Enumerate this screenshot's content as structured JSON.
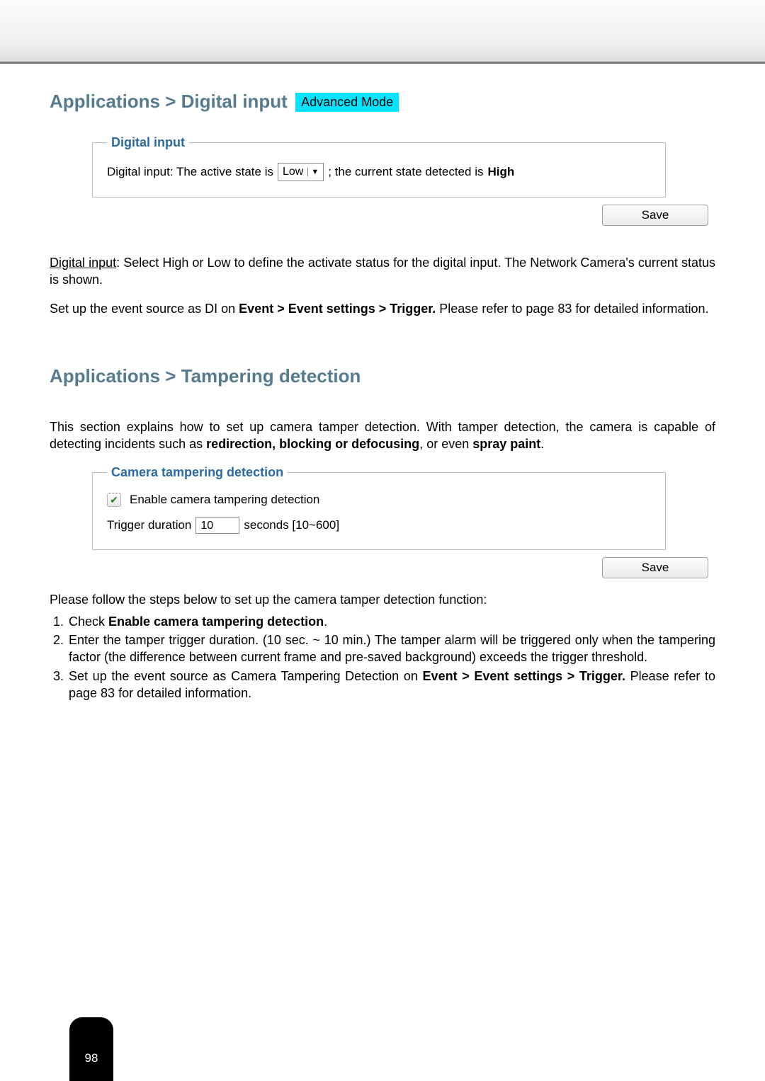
{
  "section1": {
    "title": "Applications > Digital input",
    "badge": "Advanced Mode",
    "fieldset_legend": "Digital input",
    "label_pre": "Digital input: The active state is",
    "select_value": "Low",
    "label_post": "; the current state detected is",
    "state_value": "High",
    "save": "Save",
    "para1_underline": "Digital input",
    "para1_rest": ": Select High or Low to define the activate status for the digital input. The Network Camera's current status is shown.",
    "para2_pre": "Set up the event source as DI on ",
    "para2_bold": "Event > Event settings > Trigger.",
    "para2_post": " Please refer to page 83 for detailed information."
  },
  "section2": {
    "title": "Applications > Tampering detection",
    "intro_pre": "This section explains how to set up camera tamper detection. With tamper detection, the camera is capable of detecting incidents such as ",
    "intro_bold1": "redirection, blocking or defocusing",
    "intro_mid": ", or even ",
    "intro_bold2": "spray paint",
    "intro_end": ".",
    "fieldset_legend": "Camera tampering detection",
    "checkbox_label": "Enable camera tampering detection",
    "trigger_label": "Trigger duration",
    "trigger_value": "10",
    "trigger_unit": "seconds [10~600]",
    "save": "Save",
    "steps_intro": "Please follow the steps below to set up the camera tamper detection function:",
    "step1_pre": "Check ",
    "step1_bold": "Enable camera tampering detection",
    "step1_post": ".",
    "step2": "Enter the tamper trigger duration. (10 sec. ~ 10 min.) The tamper alarm will be triggered only when the tampering factor (the difference between current frame and pre-saved background) exceeds the trigger threshold.",
    "step3_pre": "Set up the event source as Camera Tampering Detection on ",
    "step3_bold": "Event > Event settings > Trigger.",
    "step3_post": " Please refer to page 83 for detailed information."
  },
  "page_number": "98"
}
